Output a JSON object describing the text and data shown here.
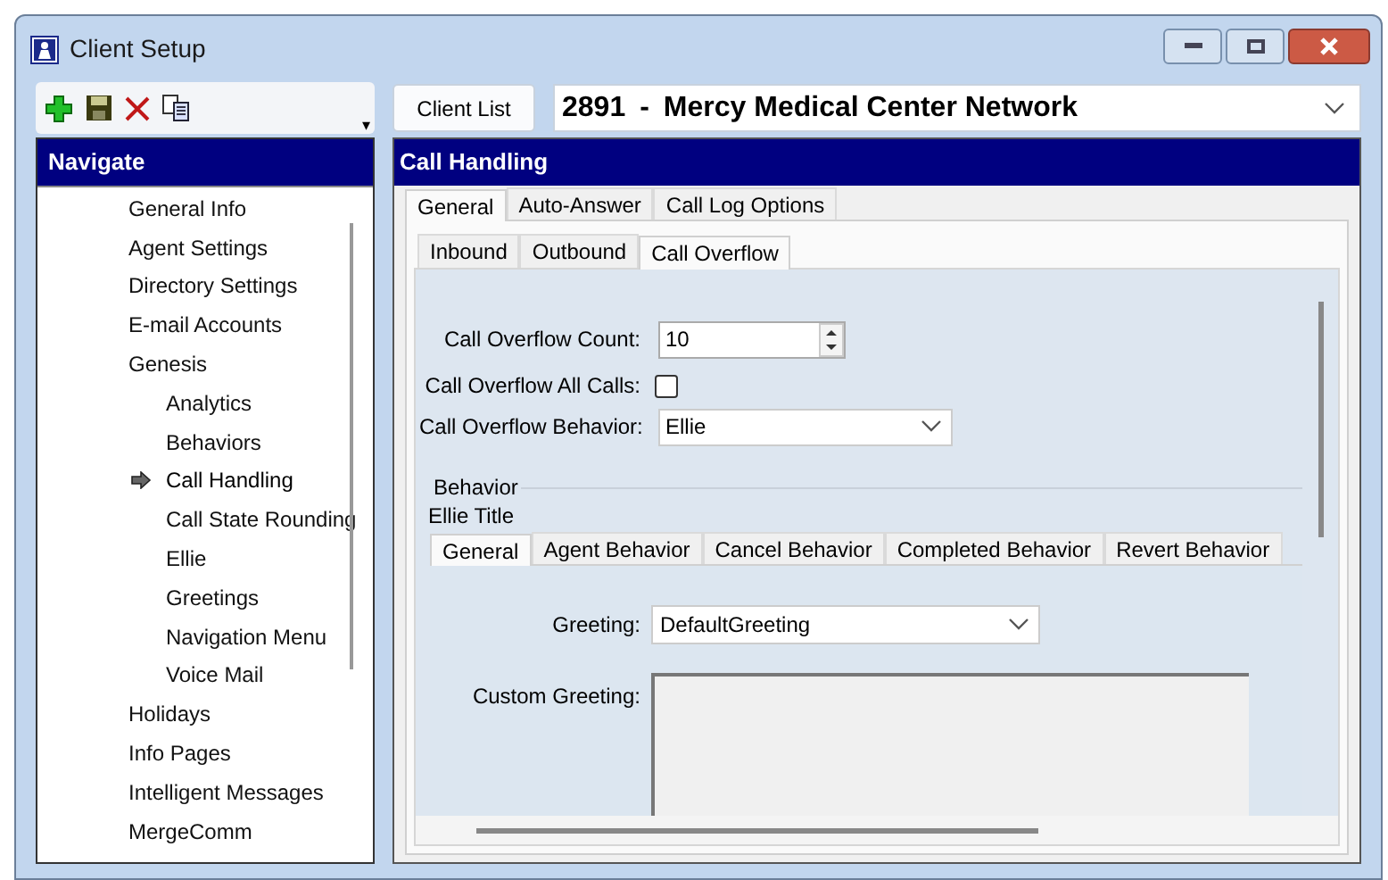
{
  "window": {
    "title": "Client Setup"
  },
  "toolbar": {
    "overflow_glyph": "▾"
  },
  "navigate": {
    "title": "Navigate",
    "items": [
      {
        "label": "General Info",
        "selected": false
      },
      {
        "label": "Agent Settings",
        "selected": false
      },
      {
        "label": "Directory Settings",
        "selected": false
      },
      {
        "label": "E-mail Accounts",
        "selected": false
      },
      {
        "label": "Genesis",
        "selected": false,
        "children": [
          {
            "label": "Analytics",
            "selected": false
          },
          {
            "label": "Behaviors",
            "selected": false
          },
          {
            "label": "Call Handling",
            "selected": true
          },
          {
            "label": "Call State Rounding",
            "selected": false
          },
          {
            "label": "Ellie",
            "selected": false
          },
          {
            "label": "Greetings",
            "selected": false
          },
          {
            "label": "Navigation Menu",
            "selected": false
          },
          {
            "label": "Voice Mail",
            "selected": false
          }
        ]
      },
      {
        "label": "Holidays",
        "selected": false
      },
      {
        "label": "Info Pages",
        "selected": false
      },
      {
        "label": "Intelligent Messages",
        "selected": false
      },
      {
        "label": "MergeComm",
        "selected": false
      }
    ]
  },
  "client_list_button": "Client List",
  "client": {
    "number": "2891",
    "separator": "-",
    "name": "Mercy Medical Center Network"
  },
  "section": {
    "title": "Call Handling"
  },
  "tabs": [
    {
      "label": "General",
      "selected": true
    },
    {
      "label": "Auto-Answer",
      "selected": false
    },
    {
      "label": "Call Log Options",
      "selected": false
    }
  ],
  "subtabs": [
    {
      "label": "Inbound",
      "selected": false
    },
    {
      "label": "Outbound",
      "selected": false
    },
    {
      "label": "Call Overflow",
      "selected": true
    }
  ],
  "form": {
    "count": {
      "label": "Call Overflow Count:",
      "value": "10"
    },
    "all_calls": {
      "label": "Call Overflow All Calls:",
      "checked": false
    },
    "behavior": {
      "label": "Call Overflow Behavior:",
      "value": "Ellie"
    }
  },
  "behavior_group": {
    "title": "Behavior",
    "subtitle": "Ellie Title",
    "tabs": [
      {
        "label": "General",
        "selected": true
      },
      {
        "label": "Agent Behavior",
        "selected": false
      },
      {
        "label": "Cancel Behavior",
        "selected": false
      },
      {
        "label": "Completed Behavior",
        "selected": false
      },
      {
        "label": "Revert Behavior",
        "selected": false
      }
    ],
    "greeting": {
      "label": "Greeting:",
      "value": "DefaultGreeting"
    },
    "custom_greeting": {
      "label": "Custom Greeting:"
    }
  }
}
